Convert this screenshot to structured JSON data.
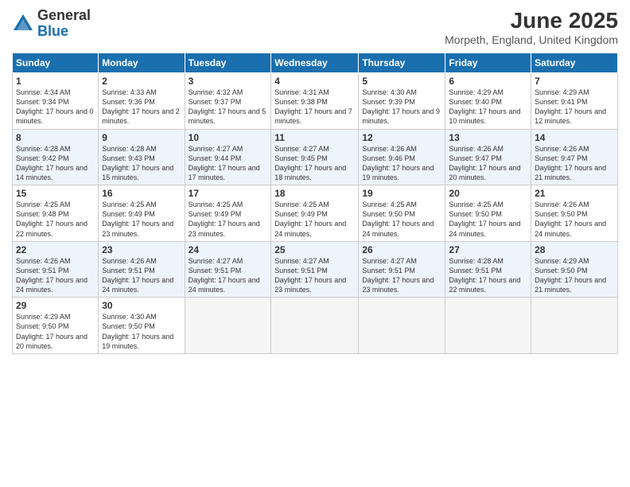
{
  "logo": {
    "general": "General",
    "blue": "Blue"
  },
  "title": "June 2025",
  "location": "Morpeth, England, United Kingdom",
  "days_header": [
    "Sunday",
    "Monday",
    "Tuesday",
    "Wednesday",
    "Thursday",
    "Friday",
    "Saturday"
  ],
  "weeks": [
    [
      {
        "num": "1",
        "sunrise": "4:34 AM",
        "sunset": "9:34 PM",
        "daylight": "17 hours and 0 minutes."
      },
      {
        "num": "2",
        "sunrise": "4:33 AM",
        "sunset": "9:36 PM",
        "daylight": "17 hours and 2 minutes."
      },
      {
        "num": "3",
        "sunrise": "4:32 AM",
        "sunset": "9:37 PM",
        "daylight": "17 hours and 5 minutes."
      },
      {
        "num": "4",
        "sunrise": "4:31 AM",
        "sunset": "9:38 PM",
        "daylight": "17 hours and 7 minutes."
      },
      {
        "num": "5",
        "sunrise": "4:30 AM",
        "sunset": "9:39 PM",
        "daylight": "17 hours and 9 minutes."
      },
      {
        "num": "6",
        "sunrise": "4:29 AM",
        "sunset": "9:40 PM",
        "daylight": "17 hours and 10 minutes."
      },
      {
        "num": "7",
        "sunrise": "4:29 AM",
        "sunset": "9:41 PM",
        "daylight": "17 hours and 12 minutes."
      }
    ],
    [
      {
        "num": "8",
        "sunrise": "4:28 AM",
        "sunset": "9:42 PM",
        "daylight": "17 hours and 14 minutes."
      },
      {
        "num": "9",
        "sunrise": "4:28 AM",
        "sunset": "9:43 PM",
        "daylight": "17 hours and 15 minutes."
      },
      {
        "num": "10",
        "sunrise": "4:27 AM",
        "sunset": "9:44 PM",
        "daylight": "17 hours and 17 minutes."
      },
      {
        "num": "11",
        "sunrise": "4:27 AM",
        "sunset": "9:45 PM",
        "daylight": "17 hours and 18 minutes."
      },
      {
        "num": "12",
        "sunrise": "4:26 AM",
        "sunset": "9:46 PM",
        "daylight": "17 hours and 19 minutes."
      },
      {
        "num": "13",
        "sunrise": "4:26 AM",
        "sunset": "9:47 PM",
        "daylight": "17 hours and 20 minutes."
      },
      {
        "num": "14",
        "sunrise": "4:26 AM",
        "sunset": "9:47 PM",
        "daylight": "17 hours and 21 minutes."
      }
    ],
    [
      {
        "num": "15",
        "sunrise": "4:25 AM",
        "sunset": "9:48 PM",
        "daylight": "17 hours and 22 minutes."
      },
      {
        "num": "16",
        "sunrise": "4:25 AM",
        "sunset": "9:49 PM",
        "daylight": "17 hours and 23 minutes."
      },
      {
        "num": "17",
        "sunrise": "4:25 AM",
        "sunset": "9:49 PM",
        "daylight": "17 hours and 23 minutes."
      },
      {
        "num": "18",
        "sunrise": "4:25 AM",
        "sunset": "9:49 PM",
        "daylight": "17 hours and 24 minutes."
      },
      {
        "num": "19",
        "sunrise": "4:25 AM",
        "sunset": "9:50 PM",
        "daylight": "17 hours and 24 minutes."
      },
      {
        "num": "20",
        "sunrise": "4:25 AM",
        "sunset": "9:50 PM",
        "daylight": "17 hours and 24 minutes."
      },
      {
        "num": "21",
        "sunrise": "4:26 AM",
        "sunset": "9:50 PM",
        "daylight": "17 hours and 24 minutes."
      }
    ],
    [
      {
        "num": "22",
        "sunrise": "4:26 AM",
        "sunset": "9:51 PM",
        "daylight": "17 hours and 24 minutes."
      },
      {
        "num": "23",
        "sunrise": "4:26 AM",
        "sunset": "9:51 PM",
        "daylight": "17 hours and 24 minutes."
      },
      {
        "num": "24",
        "sunrise": "4:27 AM",
        "sunset": "9:51 PM",
        "daylight": "17 hours and 24 minutes."
      },
      {
        "num": "25",
        "sunrise": "4:27 AM",
        "sunset": "9:51 PM",
        "daylight": "17 hours and 23 minutes."
      },
      {
        "num": "26",
        "sunrise": "4:27 AM",
        "sunset": "9:51 PM",
        "daylight": "17 hours and 23 minutes."
      },
      {
        "num": "27",
        "sunrise": "4:28 AM",
        "sunset": "9:51 PM",
        "daylight": "17 hours and 22 minutes."
      },
      {
        "num": "28",
        "sunrise": "4:29 AM",
        "sunset": "9:50 PM",
        "daylight": "17 hours and 21 minutes."
      }
    ],
    [
      {
        "num": "29",
        "sunrise": "4:29 AM",
        "sunset": "9:50 PM",
        "daylight": "17 hours and 20 minutes."
      },
      {
        "num": "30",
        "sunrise": "4:30 AM",
        "sunset": "9:50 PM",
        "daylight": "17 hours and 19 minutes."
      },
      null,
      null,
      null,
      null,
      null
    ]
  ],
  "labels": {
    "sunrise": "Sunrise:",
    "sunset": "Sunset:",
    "daylight": "Daylight:"
  }
}
